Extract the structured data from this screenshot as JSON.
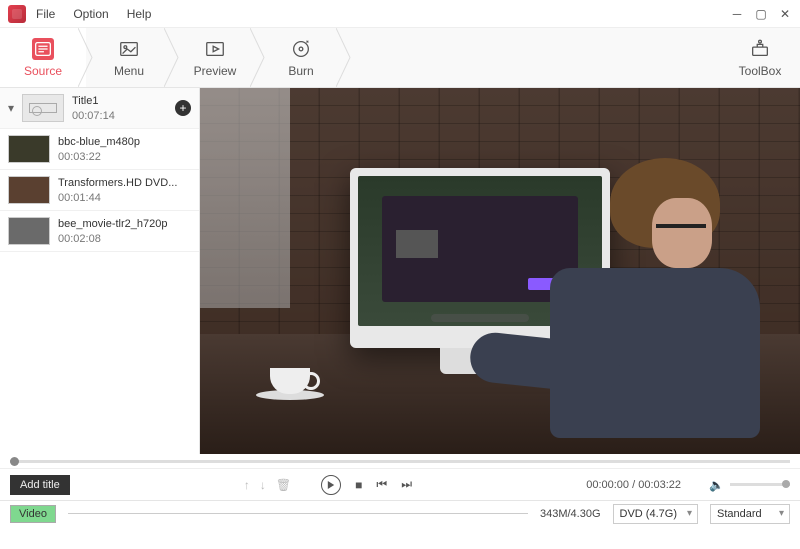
{
  "menubar": {
    "file": "File",
    "option": "Option",
    "help": "Help"
  },
  "tabs": {
    "source": "Source",
    "menu": "Menu",
    "preview": "Preview",
    "burn": "Burn",
    "toolbox": "ToolBox"
  },
  "titles": [
    {
      "name": "Title1",
      "duration": "00:07:14",
      "header": true
    },
    {
      "name": "bbc-blue_m480p",
      "duration": "00:03:22"
    },
    {
      "name": "Transformers.HD DVD...",
      "duration": "00:01:44"
    },
    {
      "name": "bee_movie-tlr2_h720p",
      "duration": "00:02:08"
    }
  ],
  "controls": {
    "add_title": "Add title",
    "time_current": "00:00:00",
    "time_sep": " / ",
    "time_total": "00:03:22"
  },
  "status": {
    "track_label": "Video",
    "size": "343M/4.30G",
    "disc_type": "DVD (4.7G)",
    "quality": "Standard"
  }
}
